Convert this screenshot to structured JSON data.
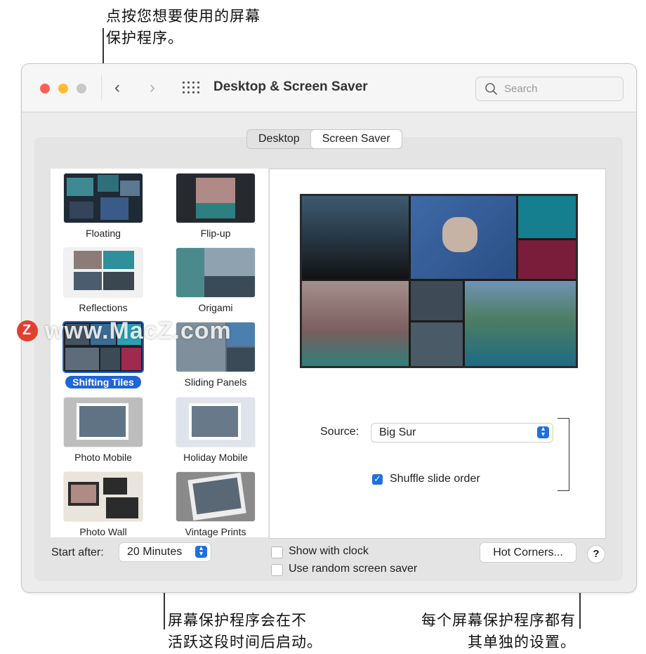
{
  "callouts": {
    "top_line1": "点按您想要使用的屏幕",
    "top_line2": "保护程序。",
    "bottom_left_line1": "屏幕保护程序会在不",
    "bottom_left_line2": "活跃这段时间后启动。",
    "bottom_right_line1": "每个屏幕保护程序都有",
    "bottom_right_line2": "其单独的设置。"
  },
  "window": {
    "title": "Desktop & Screen Saver",
    "back_glyph": "‹",
    "forward_glyph": "›",
    "search_placeholder": "Search",
    "icons": [
      "search-icon",
      "grid-icon",
      "chevron-left-icon",
      "chevron-right-icon"
    ]
  },
  "tabs": [
    {
      "label": "Desktop",
      "selected": false
    },
    {
      "label": "Screen Saver",
      "selected": true
    }
  ],
  "savers": [
    {
      "name": "Floating"
    },
    {
      "name": "Flip-up"
    },
    {
      "name": "Reflections"
    },
    {
      "name": "Origami"
    },
    {
      "name": "Shifting Tiles",
      "selected": true
    },
    {
      "name": "Sliding Panels"
    },
    {
      "name": "Photo Mobile"
    },
    {
      "name": "Holiday Mobile"
    },
    {
      "name": "Photo Wall"
    },
    {
      "name": "Vintage Prints"
    }
  ],
  "options": {
    "source_label": "Source:",
    "source_value": "Big Sur",
    "shuffle_label": "Shuffle slide order",
    "shuffle_checked": true
  },
  "bottom": {
    "start_after_label": "Start after:",
    "start_after_value": "20 Minutes",
    "show_clock_label": "Show with clock",
    "show_clock_checked": false,
    "random_label": "Use random screen saver",
    "random_checked": false,
    "hot_corners_label": "Hot Corners...",
    "help_label": "?"
  },
  "watermark": {
    "logo": "Z",
    "text": "www.MacZ.com"
  },
  "colors": {
    "accent": "#1f6fe0",
    "selection": "#1f64d8",
    "close": "#ff5f57",
    "minimize": "#febc2e",
    "zoom": "#c8c8c8"
  }
}
